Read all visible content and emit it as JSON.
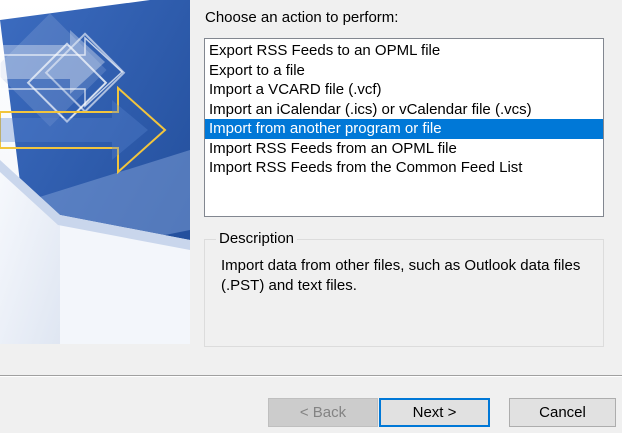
{
  "wizard": {
    "prompt": "Choose an action to perform:",
    "actions": [
      {
        "label": "Export RSS Feeds to an OPML file",
        "selected": false
      },
      {
        "label": "Export to a file",
        "selected": false
      },
      {
        "label": "Import a VCARD file (.vcf)",
        "selected": false
      },
      {
        "label": "Import an iCalendar (.ics) or vCalendar file (.vcs)",
        "selected": false
      },
      {
        "label": "Import from another program or file",
        "selected": true
      },
      {
        "label": "Import RSS Feeds from an OPML file",
        "selected": false
      },
      {
        "label": "Import RSS Feeds from the Common Feed List",
        "selected": false
      }
    ],
    "description": {
      "legend": "Description",
      "text": "Import data from other files, such as Outlook data files (.PST) and text files."
    }
  },
  "buttons": {
    "back_label": "< Back",
    "next_label": "Next >",
    "cancel_label": "Cancel"
  },
  "colors": {
    "selection": "#0078d7",
    "window_background": "#f0f0f0",
    "graphic_blue": "#3462b4",
    "arrow_yellow": "#f2c53d"
  }
}
